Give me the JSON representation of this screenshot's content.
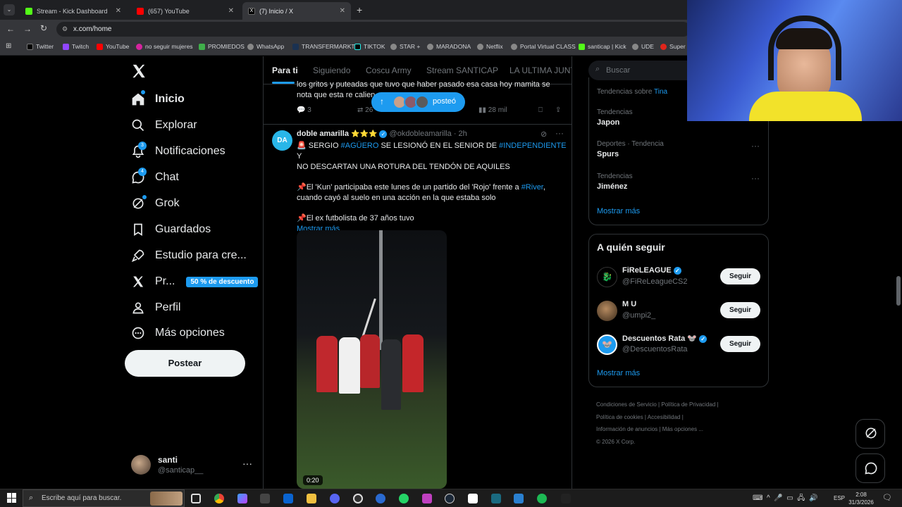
{
  "browser": {
    "tabs": [
      {
        "label": "Stream - Kick Dashboard",
        "color": "#53fc18"
      },
      {
        "label": "(657) YouTube",
        "color": "#ff0000"
      },
      {
        "label": "(7) Inicio / X",
        "color": "#ffffff"
      }
    ],
    "url": "x.com/home",
    "bookmarks": [
      "Twitter",
      "Twitch",
      "YouTube",
      "no seguir mujeres",
      "PROMIEDOS",
      "WhatsApp",
      "TRANSFERMARKT",
      "TIKTOK",
      "STAR +",
      "MARADONA",
      "Netflix",
      "Portal Virtual CLASS",
      "santicap | Kick",
      "UDE",
      "Super"
    ]
  },
  "nav": {
    "items": [
      {
        "label": "Inicio",
        "icon": "home-icon"
      },
      {
        "label": "Explorar",
        "icon": "search-icon"
      },
      {
        "label": "Notificaciones",
        "icon": "bell-icon",
        "badge": "3"
      },
      {
        "label": "Chat",
        "icon": "chat-icon",
        "badge": "4"
      },
      {
        "label": "Grok",
        "icon": "grok-icon"
      },
      {
        "label": "Guardados",
        "icon": "bookmark-icon"
      },
      {
        "label": "Estudio para cre...",
        "icon": "rocket-icon"
      },
      {
        "label": "Pr...",
        "icon": "x-icon",
        "pill": "50 % de descuento"
      },
      {
        "label": "Perfil",
        "icon": "person-icon"
      },
      {
        "label": "Más opciones",
        "icon": "more-circle-icon"
      }
    ],
    "post_button": "Postear",
    "account": {
      "name": "santi",
      "handle": "@santicap__"
    }
  },
  "feed": {
    "tabs": [
      "Para ti",
      "Siguiendo",
      "Coscu Army",
      "Stream SANTICAP",
      "LA ULTIMA JUNTA"
    ],
    "prev_post": {
      "text": "los gritos y puteadas que tuvo que haber pasado esa casa hoy mamita se nota que esta re calien",
      "replies": "3",
      "reposts": "26",
      "likes": "1 mil",
      "views": "28 mil"
    },
    "posted_pill": "posteó",
    "post": {
      "avatar_text": "DA",
      "author": "doble amarilla",
      "stars": "⭐⭐⭐",
      "handle": "@okdobleamarilla",
      "time": "· 2h",
      "line1_pre": "🚨 SERGIO ",
      "line1_tag1": "#AGÜERO",
      "line1_mid": " SE LESIONÓ EN EL SENIOR DE ",
      "line1_tag2": "#INDEPENDIENTE",
      "line1_post": " Y",
      "line2": "NO DESCARTAN UNA ROTURA DEL TENDÓN DE AQUILES",
      "para2_pre": "📌El 'Kun' participaba este lunes de un partido del 'Rojo' frente a ",
      "para2_tag": "#River",
      "para2_post": ",",
      "para2_line2": "cuando cayó al suelo en una acción en la que estaba solo",
      "para3": "📌El ex futbolista de 37 años tuvo",
      "show_more": "Mostrar más",
      "video_time": "0:20"
    }
  },
  "right": {
    "search_placeholder": "Buscar",
    "trends_about": "Tendencias sobre",
    "trends_about_name": "Tina",
    "trends": [
      {
        "context": "Tendencias",
        "name": "Japon"
      },
      {
        "context": "Deportes · Tendencia",
        "name": "Spurs"
      },
      {
        "context": "Tendencias",
        "name": "Jiménez"
      }
    ],
    "trends_more": "Mostrar más",
    "who_to_follow_title": "A quién seguir",
    "who_to_follow": [
      {
        "name": "FiReLEAGUE",
        "handle": "@FiReLeagueCS2",
        "verified": true
      },
      {
        "name": "M U",
        "handle": "@umpi2_",
        "verified": false
      },
      {
        "name": "Descuentos Rata 🐭",
        "handle": "@DescuentosRata",
        "verified": true
      }
    ],
    "follow_label": "Seguir",
    "follow_more": "Mostrar más",
    "footer": {
      "terms": "Condiciones de Servicio",
      "privacy": "Política de Privacidad",
      "cookies": "Política de cookies",
      "accessibility": "Accesibilidad",
      "ads": "Información de anuncios",
      "more": "Más opciones ...",
      "copyright": "© 2026 X Corp."
    }
  },
  "taskbar": {
    "search_placeholder": "Escribe aquí para buscar.",
    "lang": "ESP",
    "time": "2:08",
    "date": "31/3/2026"
  }
}
